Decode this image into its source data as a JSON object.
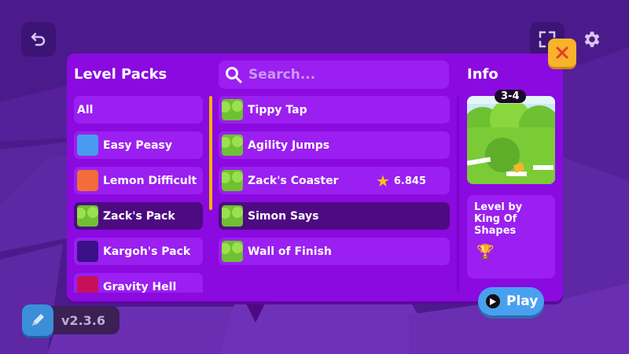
{
  "header": {
    "packs_title": "Level Packs",
    "info_title": "Info"
  },
  "search": {
    "placeholder": "Search..."
  },
  "packs": [
    {
      "label": "All",
      "thumb": "none",
      "selected": false
    },
    {
      "label": "Easy Peasy",
      "thumb": "blue",
      "selected": false
    },
    {
      "label": "Lemon Difficult",
      "thumb": "orange",
      "selected": false
    },
    {
      "label": "Zack's Pack",
      "thumb": "green",
      "selected": true
    },
    {
      "label": "Kargoh's Pack",
      "thumb": "purple",
      "selected": false
    },
    {
      "label": "Gravity Hell",
      "thumb": "magenta",
      "selected": false
    }
  ],
  "levels": [
    {
      "label": "Tippy Tap",
      "selected": false
    },
    {
      "label": "Agility Jumps",
      "selected": false
    },
    {
      "label": "Zack's Coaster",
      "selected": false,
      "rating": "6.845"
    },
    {
      "label": "Simon Says",
      "selected": true
    },
    {
      "label": "Wall of Finish",
      "selected": false
    }
  ],
  "info": {
    "level_code": "3-4",
    "author": "Level by King Of Shapes",
    "trophy_icon": "trophy-icon"
  },
  "buttons": {
    "play_label": "Play"
  },
  "footer": {
    "version": "v2.3.6"
  },
  "colors": {
    "panel": "#8a0ae0",
    "row": "#9b1ff0",
    "row_selected": "#4d0a82",
    "accent_yellow": "#f7b32b",
    "play_blue": "#4aa0f0"
  }
}
